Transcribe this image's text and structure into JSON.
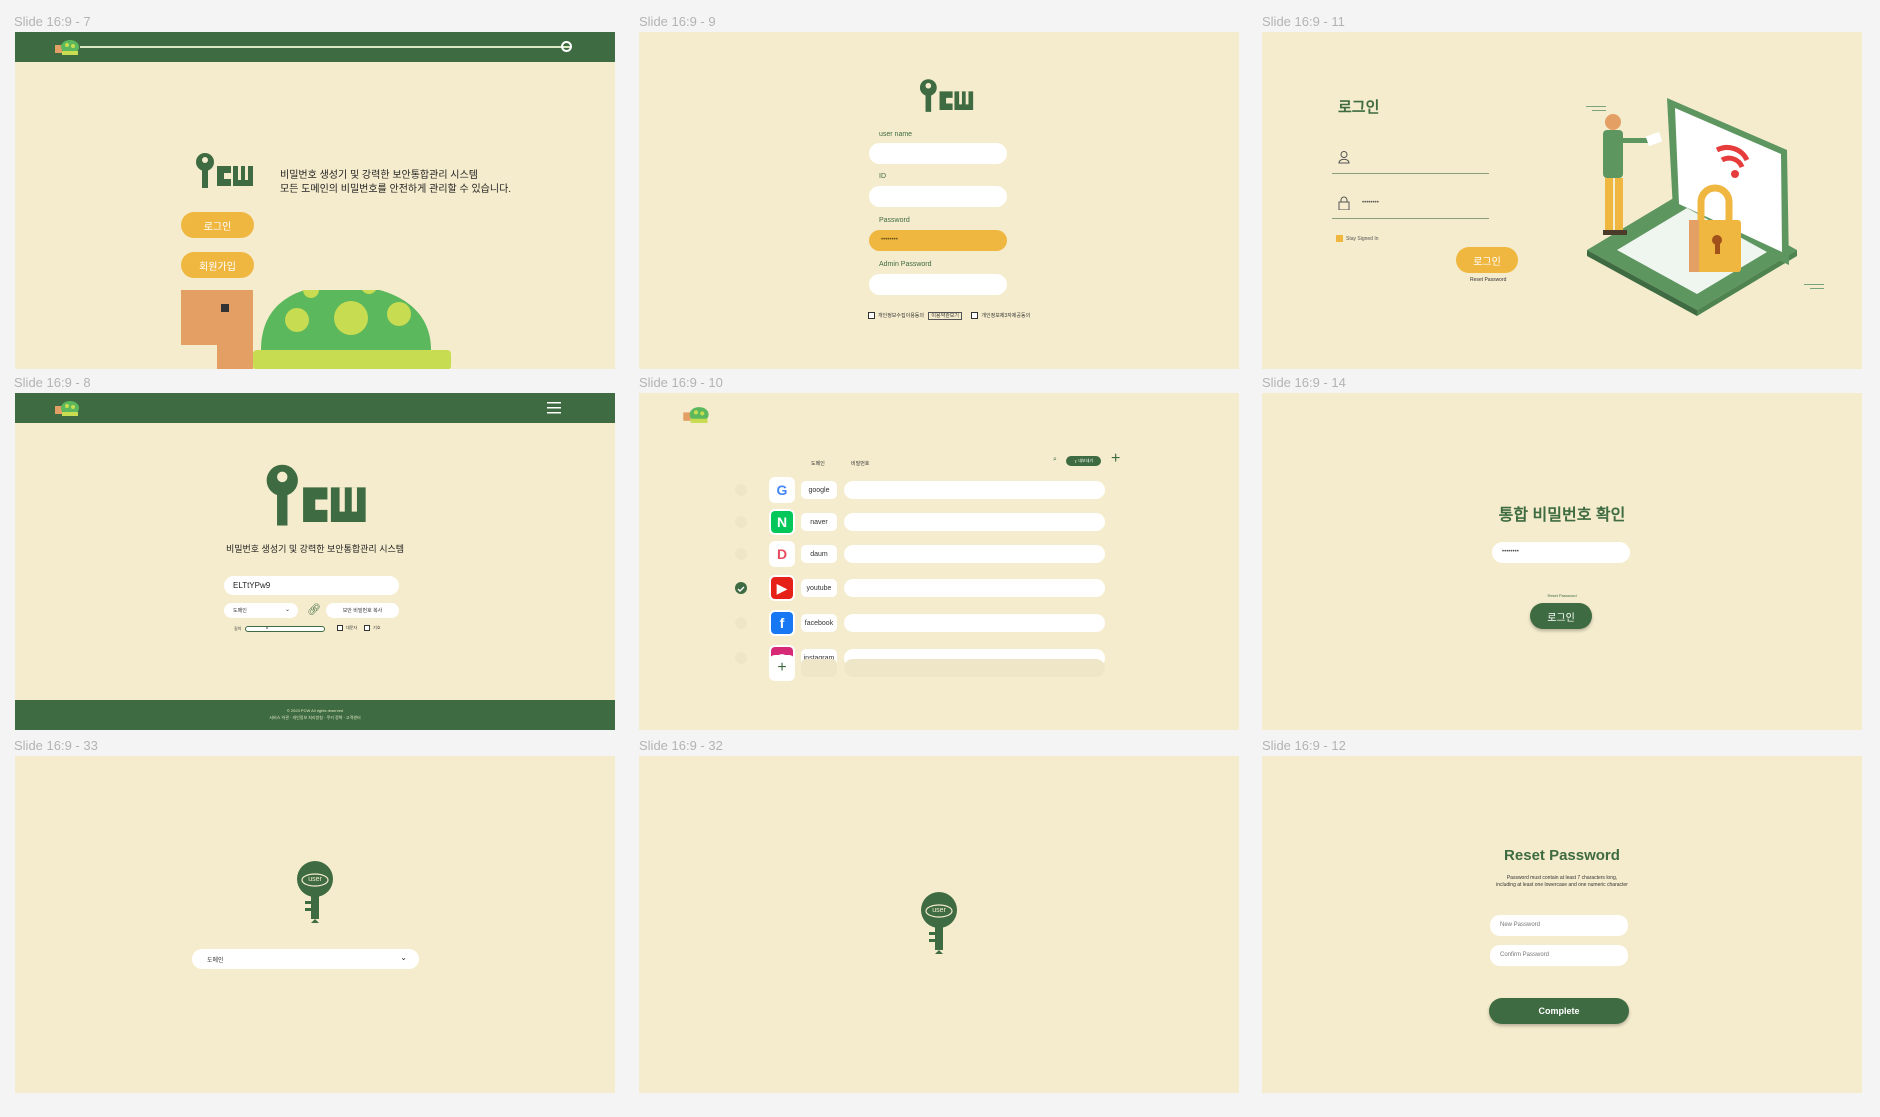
{
  "frames": {
    "f7": "Slide 16:9 - 7",
    "f9": "Slide 16:9 - 9",
    "f11": "Slide 16:9 - 11",
    "f8": "Slide 16:9 - 8",
    "f10": "Slide 16:9 - 10",
    "f14": "Slide 16:9 - 14",
    "f33": "Slide 16:9 - 33",
    "f32": "Slide 16:9 - 32",
    "f12": "Slide 16:9 - 12"
  },
  "logo_text": "Pcw",
  "landing": {
    "tagline1": "비밀번호 생성기 및 강력한 보안통합관리 시스템",
    "tagline2": "모든 도메인의 비밀번호를 안전하게 관리할 수 있습니다.",
    "login_button": "로그인",
    "signup_button": "회원가입"
  },
  "signup": {
    "username_label": "user name",
    "id_label": "ID",
    "password_label": "Password",
    "password_value": "••••••••",
    "admin_password_label": "Admin Password",
    "agree1": "개인정보수집이용동의",
    "agree1_link": "이용약관보기",
    "agree2": "개인정보제3자제공동의"
  },
  "login": {
    "title": "로그인",
    "password_value": "••••••••",
    "remember": "Stay Signed In",
    "button": "로그인",
    "reset": "Reset Password"
  },
  "generator": {
    "tagline": "비밀번호 생성기 및 강력한 보안통합관리 시스템",
    "password_value": "ELTtYPw9",
    "domain_select": "도메인",
    "copy_button": "보안 비밀번호 복사",
    "length_label": "길이",
    "length_value": 8,
    "opt_upper": "대문자",
    "opt_special": "기호",
    "footer1": "© 2023 PCW All rights reserved",
    "footer2": "서비스 약관 · 개인정보 처리방침 · 쿠키 정책 · 고객센터"
  },
  "vault": {
    "col_domain": "도메인",
    "col_password": "비밀번호",
    "add_chip": "내보내기",
    "rows": [
      {
        "name": "google",
        "icon": "G",
        "color": "#ffffff",
        "fg": "#4285f4",
        "checked": false
      },
      {
        "name": "naver",
        "icon": "N",
        "color": "#03c75a",
        "fg": "#ffffff",
        "checked": false
      },
      {
        "name": "daum",
        "icon": "D",
        "color": "#ffffff",
        "fg": "#e84a5f",
        "checked": false
      },
      {
        "name": "youtube",
        "icon": "▶",
        "color": "#e62117",
        "fg": "#ffffff",
        "checked": true
      },
      {
        "name": "facebook",
        "icon": "f",
        "color": "#1877f2",
        "fg": "#ffffff",
        "checked": false
      },
      {
        "name": "instagram",
        "icon": "◎",
        "color": "#d62976",
        "fg": "#ffffff",
        "checked": false
      }
    ]
  },
  "confirm": {
    "title": "통합 비밀번호 확인",
    "password_value": "••••••••",
    "reset": "Reset Password",
    "button": "로그인"
  },
  "key_user": "user",
  "domain_select_large": "도메인",
  "reset": {
    "title": "Reset Password",
    "desc1": "Password must contain at least 7 characters long,",
    "desc2": "including at least one lowercase and one numeric character",
    "new_placeholder": "New Password",
    "confirm_placeholder": "Confirm Password",
    "button": "Complete"
  },
  "colors": {
    "bg": "#f5eccd",
    "green": "#3e6b41",
    "yellow": "#efb740"
  }
}
